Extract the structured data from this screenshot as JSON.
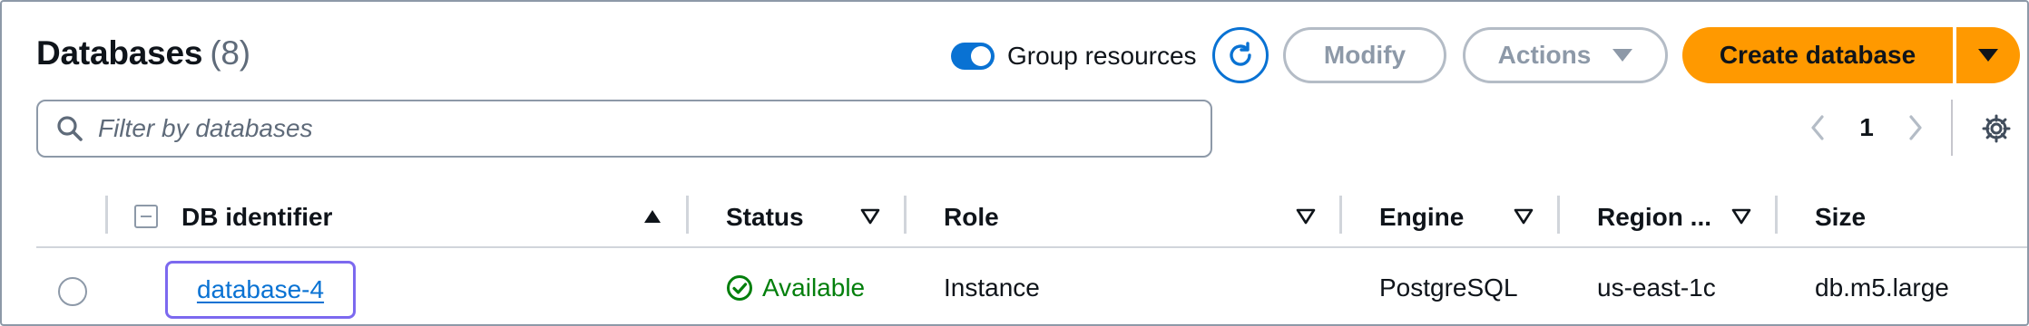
{
  "header": {
    "title": "Databases",
    "count": "(8)"
  },
  "toolbar": {
    "group_resources_label": "Group resources",
    "group_resources_on": true,
    "modify_label": "Modify",
    "actions_label": "Actions",
    "create_label": "Create database"
  },
  "search": {
    "placeholder": "Filter by databases",
    "value": ""
  },
  "pagination": {
    "current_page": "1"
  },
  "table": {
    "columns": {
      "db_identifier": "DB identifier",
      "status": "Status",
      "role": "Role",
      "engine": "Engine",
      "region": "Region ...",
      "size": "Size"
    },
    "rows": [
      {
        "db_identifier": "database-4",
        "status": "Available",
        "role": "Instance",
        "engine": "PostgreSQL",
        "region": "us-east-1c",
        "size": "db.m5.large"
      }
    ]
  },
  "colors": {
    "accent": "#0972d3",
    "primary_button": "#ff9900",
    "status_ok": "#037f0c",
    "focus_ring": "#7c69ef",
    "disabled": "#8d99a8"
  },
  "icons": {
    "search": "search-icon",
    "refresh": "refresh-icon",
    "settings": "gear-icon",
    "prev": "chevron-left-icon",
    "next": "chevron-right-icon",
    "status": "check-circle-icon"
  }
}
